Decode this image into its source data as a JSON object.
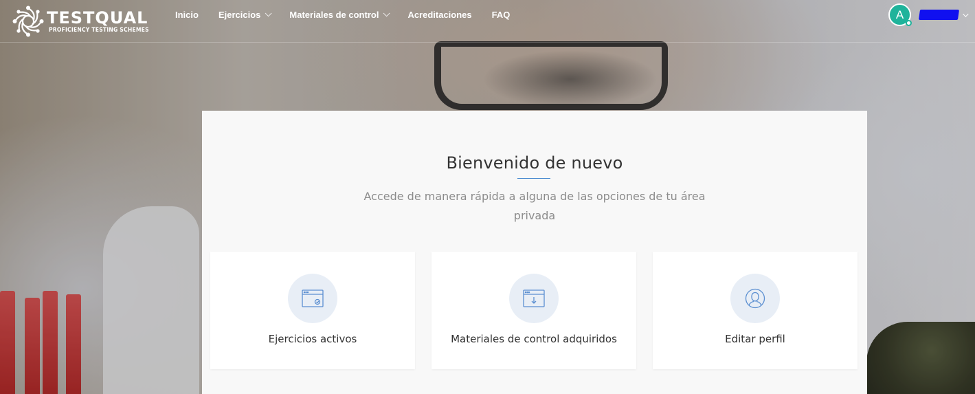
{
  "brand": {
    "name": "TESTQUAL",
    "tagline": "PROFICIENCY TESTING SCHEMES"
  },
  "nav": {
    "items": [
      {
        "label": "Inicio",
        "has_dropdown": false
      },
      {
        "label": "Ejercicios",
        "has_dropdown": true
      },
      {
        "label": "Materiales de control",
        "has_dropdown": true
      },
      {
        "label": "Acreditaciones",
        "has_dropdown": false
      },
      {
        "label": "FAQ",
        "has_dropdown": false
      }
    ]
  },
  "user": {
    "avatar_initial": "A",
    "avatar_color": "#1fb39b",
    "name": "",
    "name_redaction_color": "#1010f0"
  },
  "welcome": {
    "title": "Bienvenido de nuevo",
    "subtitle": "Accede de manera rápida a alguna de las opciones de tu área privada",
    "accent_color": "#4a8bd0"
  },
  "cards": [
    {
      "label": "Ejercicios activos",
      "icon": "window-check-icon"
    },
    {
      "label": "Materiales de control adquiridos",
      "icon": "window-download-icon"
    },
    {
      "label": "Editar perfil",
      "icon": "user-profile-icon"
    }
  ]
}
